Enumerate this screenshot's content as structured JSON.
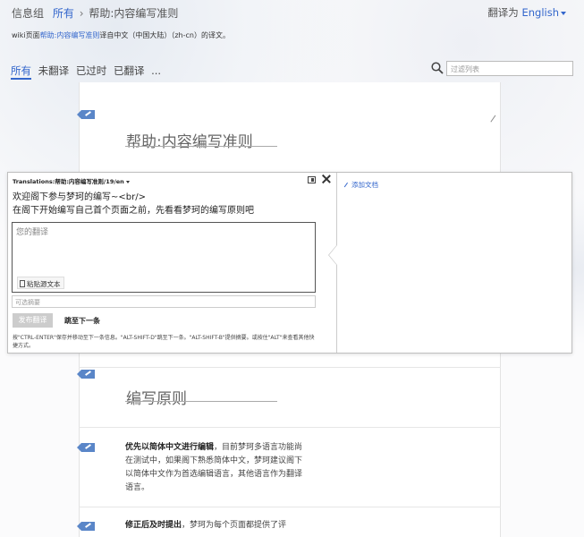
{
  "header": {
    "group_label": "信息组",
    "crumb_all": "所有",
    "crumb_sep": "›",
    "crumb_page": "帮助:内容编写准则",
    "translate_to_prefix": "翻译为",
    "translate_to_lang": "English"
  },
  "description": {
    "prefix": "wiki页面",
    "link": "帮助:内容编写准则",
    "suffix": "译自中文（中国大陆）（zh-cn）的译文。"
  },
  "filters": {
    "items": [
      {
        "label": "所有",
        "active": true
      },
      {
        "label": "未翻译",
        "active": false
      },
      {
        "label": "已过时",
        "active": false
      },
      {
        "label": "已翻译",
        "active": false
      },
      {
        "label": "...",
        "active": false
      }
    ]
  },
  "search": {
    "placeholder": "过滤列表"
  },
  "content": {
    "title1": "帮助:内容编写准则",
    "title2": "编写原则",
    "para1_bold": "优先以简体中文进行编辑",
    "para1_rest": "，目前梦珂多语言功能尚在测试中，如果阁下熟悉简体中文，梦珂建议阁下以简体中文作为首选编辑语言，其他语言作为翻译语言。",
    "para2_bold": "修正后及时提出",
    "para2_rest": "，梦珂为每个页面都提供了评"
  },
  "editor": {
    "header_prefix": "Translations:",
    "header_key": "帮助:内容编写准则/19/en",
    "source_line1": "欢迎阁下参与梦珂的编写~<br/>",
    "source_line2": "在阁下开始编写自己首个页面之前，先看看梦珂的编写原则吧",
    "placeholder": "您的翻译",
    "paste_label": "粘贴源文本",
    "summary_placeholder": "可选摘要",
    "publish_label": "发布翻译",
    "skip_label": "跳至下一条",
    "hint": "按\"CTRL-ENTER\"保存并移动至下一条信息。\"ALT-SHIFT-D\"跳至下一条。\"ALT-SHIFT-B\"提供摘要。或按住\"ALT\"来查看其他快捷方式。",
    "add_doc_label": "添加文档"
  },
  "icons": {
    "search": "search-icon",
    "close": "close-icon",
    "layout": "layout-toggle-icon",
    "pencil": "pencil-icon",
    "clipboard": "clipboard-icon"
  },
  "colors": {
    "link": "#3366cc",
    "tag": "#5a86c8",
    "publish_disabled": "#cccccc"
  }
}
